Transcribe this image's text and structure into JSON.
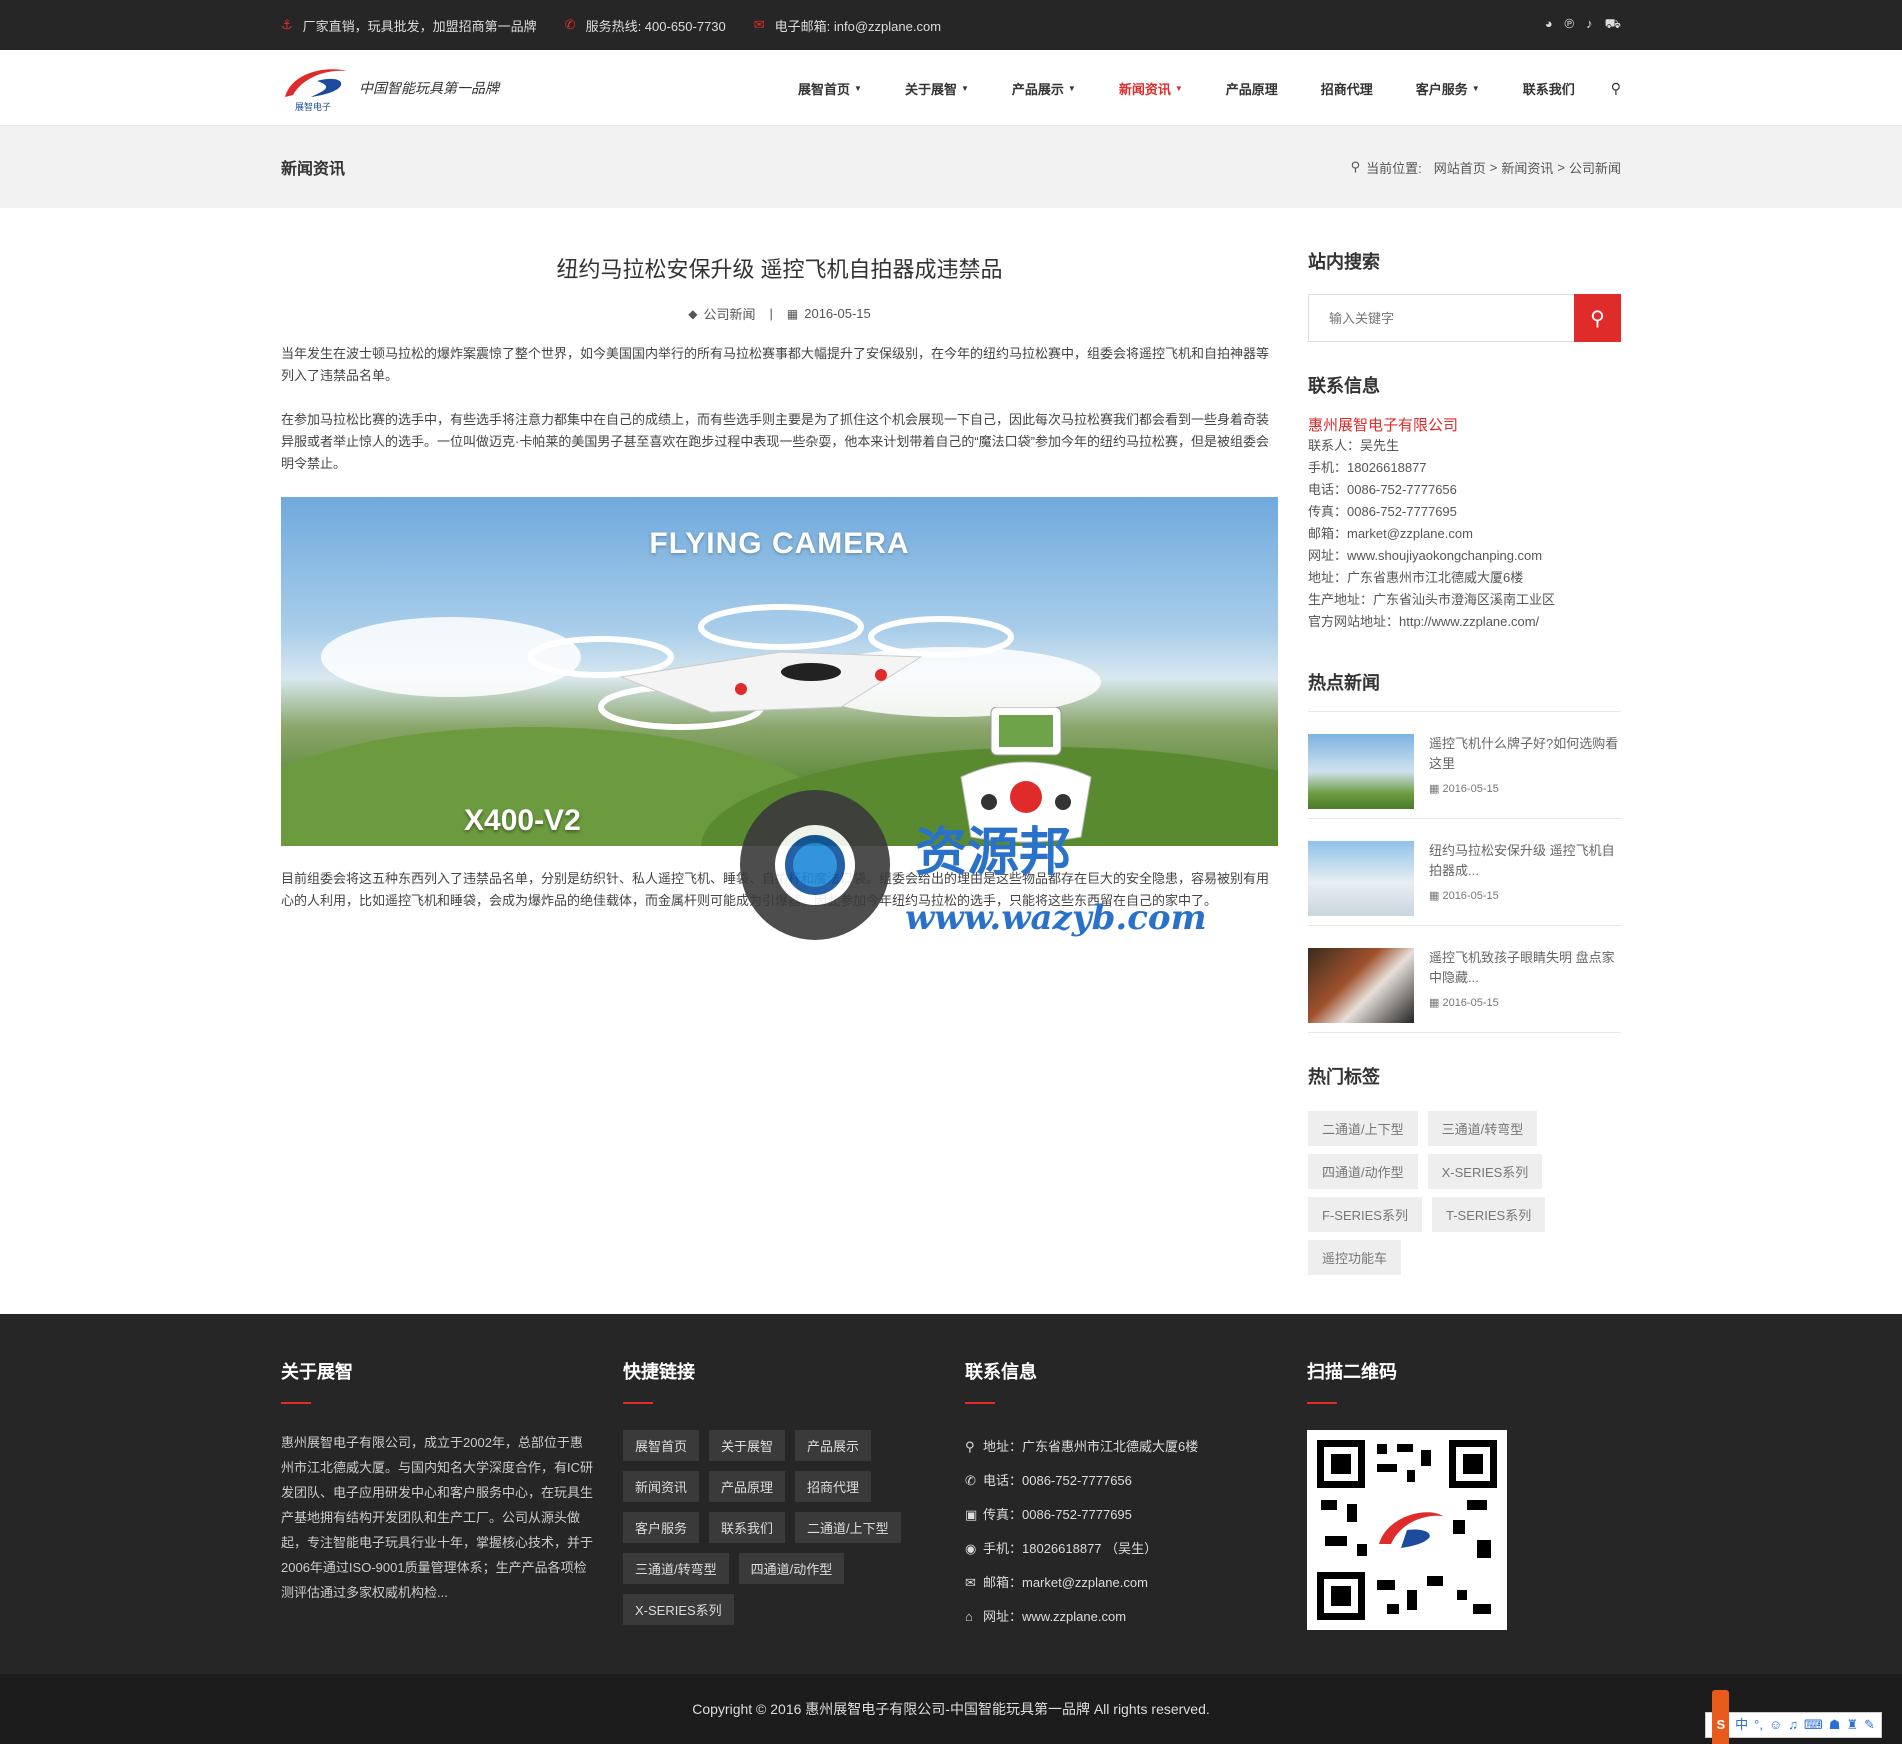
{
  "topbar": {
    "slogan": "厂家直销，玩具批发，加盟招商第一品牌",
    "hotline": "服务热线: 400-650-7730",
    "email": "电子邮箱: info@zzplane.com"
  },
  "logo": {
    "sub": "展智电子",
    "slogan": "中国智能玩具第一品牌"
  },
  "nav": [
    {
      "label": "展智首页"
    },
    {
      "label": "关于展智"
    },
    {
      "label": "产品展示"
    },
    {
      "label": "新闻资讯"
    },
    {
      "label": "产品原理"
    },
    {
      "label": "招商代理"
    },
    {
      "label": "客户服务"
    },
    {
      "label": "联系我们"
    }
  ],
  "banner": {
    "title": "新闻资讯",
    "crumb_prefix": "当前位置:",
    "crumbs": [
      "网站首页",
      "新闻资讯",
      "公司新闻"
    ]
  },
  "article": {
    "title": "纽约马拉松安保升级 遥控飞机自拍器成违禁品",
    "category": "公司新闻",
    "date": "2016-05-15",
    "p1": "当年发生在波士顿马拉松的爆炸案震惊了整个世界，如今美国国内举行的所有马拉松赛事都大幅提升了安保级别，在今年的纽约马拉松赛中，组委会将遥控飞机和自拍神器等列入了违禁品名单。",
    "p2": "在参加马拉松比赛的选手中，有些选手将注意力都集中在自己的成绩上，而有些选手则主要是为了抓住这个机会展现一下自己，因此每次马拉松赛我们都会看到一些身着奇装异服或者举止惊人的选手。一位叫做迈克·卡帕莱的美国男子甚至喜欢在跑步过程中表现一些杂耍，他本来计划带着自己的“魔法口袋”参加今年的纽约马拉松赛，但是被组委会明令禁止。",
    "hero_title": "FLYING CAMERA",
    "hero_model": "X400-V2",
    "p3": "目前组委会将这五种东西列入了违禁品名单，分别是纺织针、私人遥控飞机、睡袋、自拍杆和魔法口袋。组委会给出的理由是这些物品都存在巨大的安全隐患，容易被别有用心的人利用，比如遥控飞机和睡袋，会成为爆炸品的绝佳载体，而金属杆则可能成为引爆器。因此参加今年纽约马拉松的选手，只能将这些东西留在自己的家中了。"
  },
  "watermark": {
    "text": "资源邦",
    "url": "www.wazyb.com"
  },
  "sidebar": {
    "search_title": "站内搜索",
    "search_placeholder": "输入关键字",
    "contact_title": "联系信息",
    "company": "惠州展智电子有限公司",
    "contact_lines": [
      "联系人：吴先生",
      "手机：18026618877",
      "电话：0086-752-7777656",
      "传真：0086-752-7777695",
      "邮箱：market@zzplane.com",
      "网址：www.shoujiyaokongchanping.com",
      "地址：广东省惠州市江北德威大厦6楼",
      "生产地址：广东省汕头市澄海区溪南工业区",
      "官方网站地址：http://www.zzplane.com/"
    ],
    "hot_title": "热点新闻",
    "hot_news": [
      {
        "title": "遥控飞机什么牌子好?如何选购看这里",
        "date": "2016-05-15"
      },
      {
        "title": "纽约马拉松安保升级 遥控飞机自拍器成...",
        "date": "2016-05-15"
      },
      {
        "title": "遥控飞机致孩子眼睛失明 盘点家中隐藏...",
        "date": "2016-05-15"
      }
    ],
    "tags_title": "热门标签",
    "tags": [
      "二通道/上下型",
      "三通道/转弯型",
      "四通道/动作型",
      "X-SERIES系列",
      "F-SERIES系列",
      "T-SERIES系列",
      "遥控功能车"
    ]
  },
  "footer": {
    "about_title": "关于展智",
    "about_text": "惠州展智电子有限公司，成立于2002年，总部位于惠州市江北德威大厦。与国内知名大学深度合作，有IC研发团队、电子应用研发中心和客户服务中心，在玩具生产基地拥有结构开发团队和生产工厂。公司从源头做起，专注智能电子玩具行业十年，掌握核心技术，并于2006年通过ISO-9001质量管理体系；生产产品各项检测评估通过多家权威机构检...",
    "links_title": "快捷链接",
    "links": [
      "展智首页",
      "关于展智",
      "产品展示",
      "新闻资讯",
      "产品原理",
      "招商代理",
      "客户服务",
      "联系我们",
      "二通道/上下型",
      "三通道/转弯型",
      "四通道/动作型",
      "X-SERIES系列"
    ],
    "contact_title": "联系信息",
    "contact": [
      {
        "icon": "map-pin-icon",
        "text": "地址：广东省惠州市江北德威大厦6楼"
      },
      {
        "icon": "phone-icon",
        "text": "电话：0086-752-7777656"
      },
      {
        "icon": "fax-icon",
        "text": "传真：0086-752-7777695"
      },
      {
        "icon": "mobile-icon",
        "text": "手机：18026618877 （吴生）"
      },
      {
        "icon": "mail-icon",
        "text": "邮箱：market@zzplane.com"
      },
      {
        "icon": "home-icon",
        "text": "网址：www.zzplane.com"
      }
    ],
    "qr_title": "扫描二维码",
    "copyright": "Copyright © 2016 惠州展智电子有限公司-中国智能玩具第一品牌 All rights reserved."
  },
  "ime": {
    "lang": "中"
  }
}
